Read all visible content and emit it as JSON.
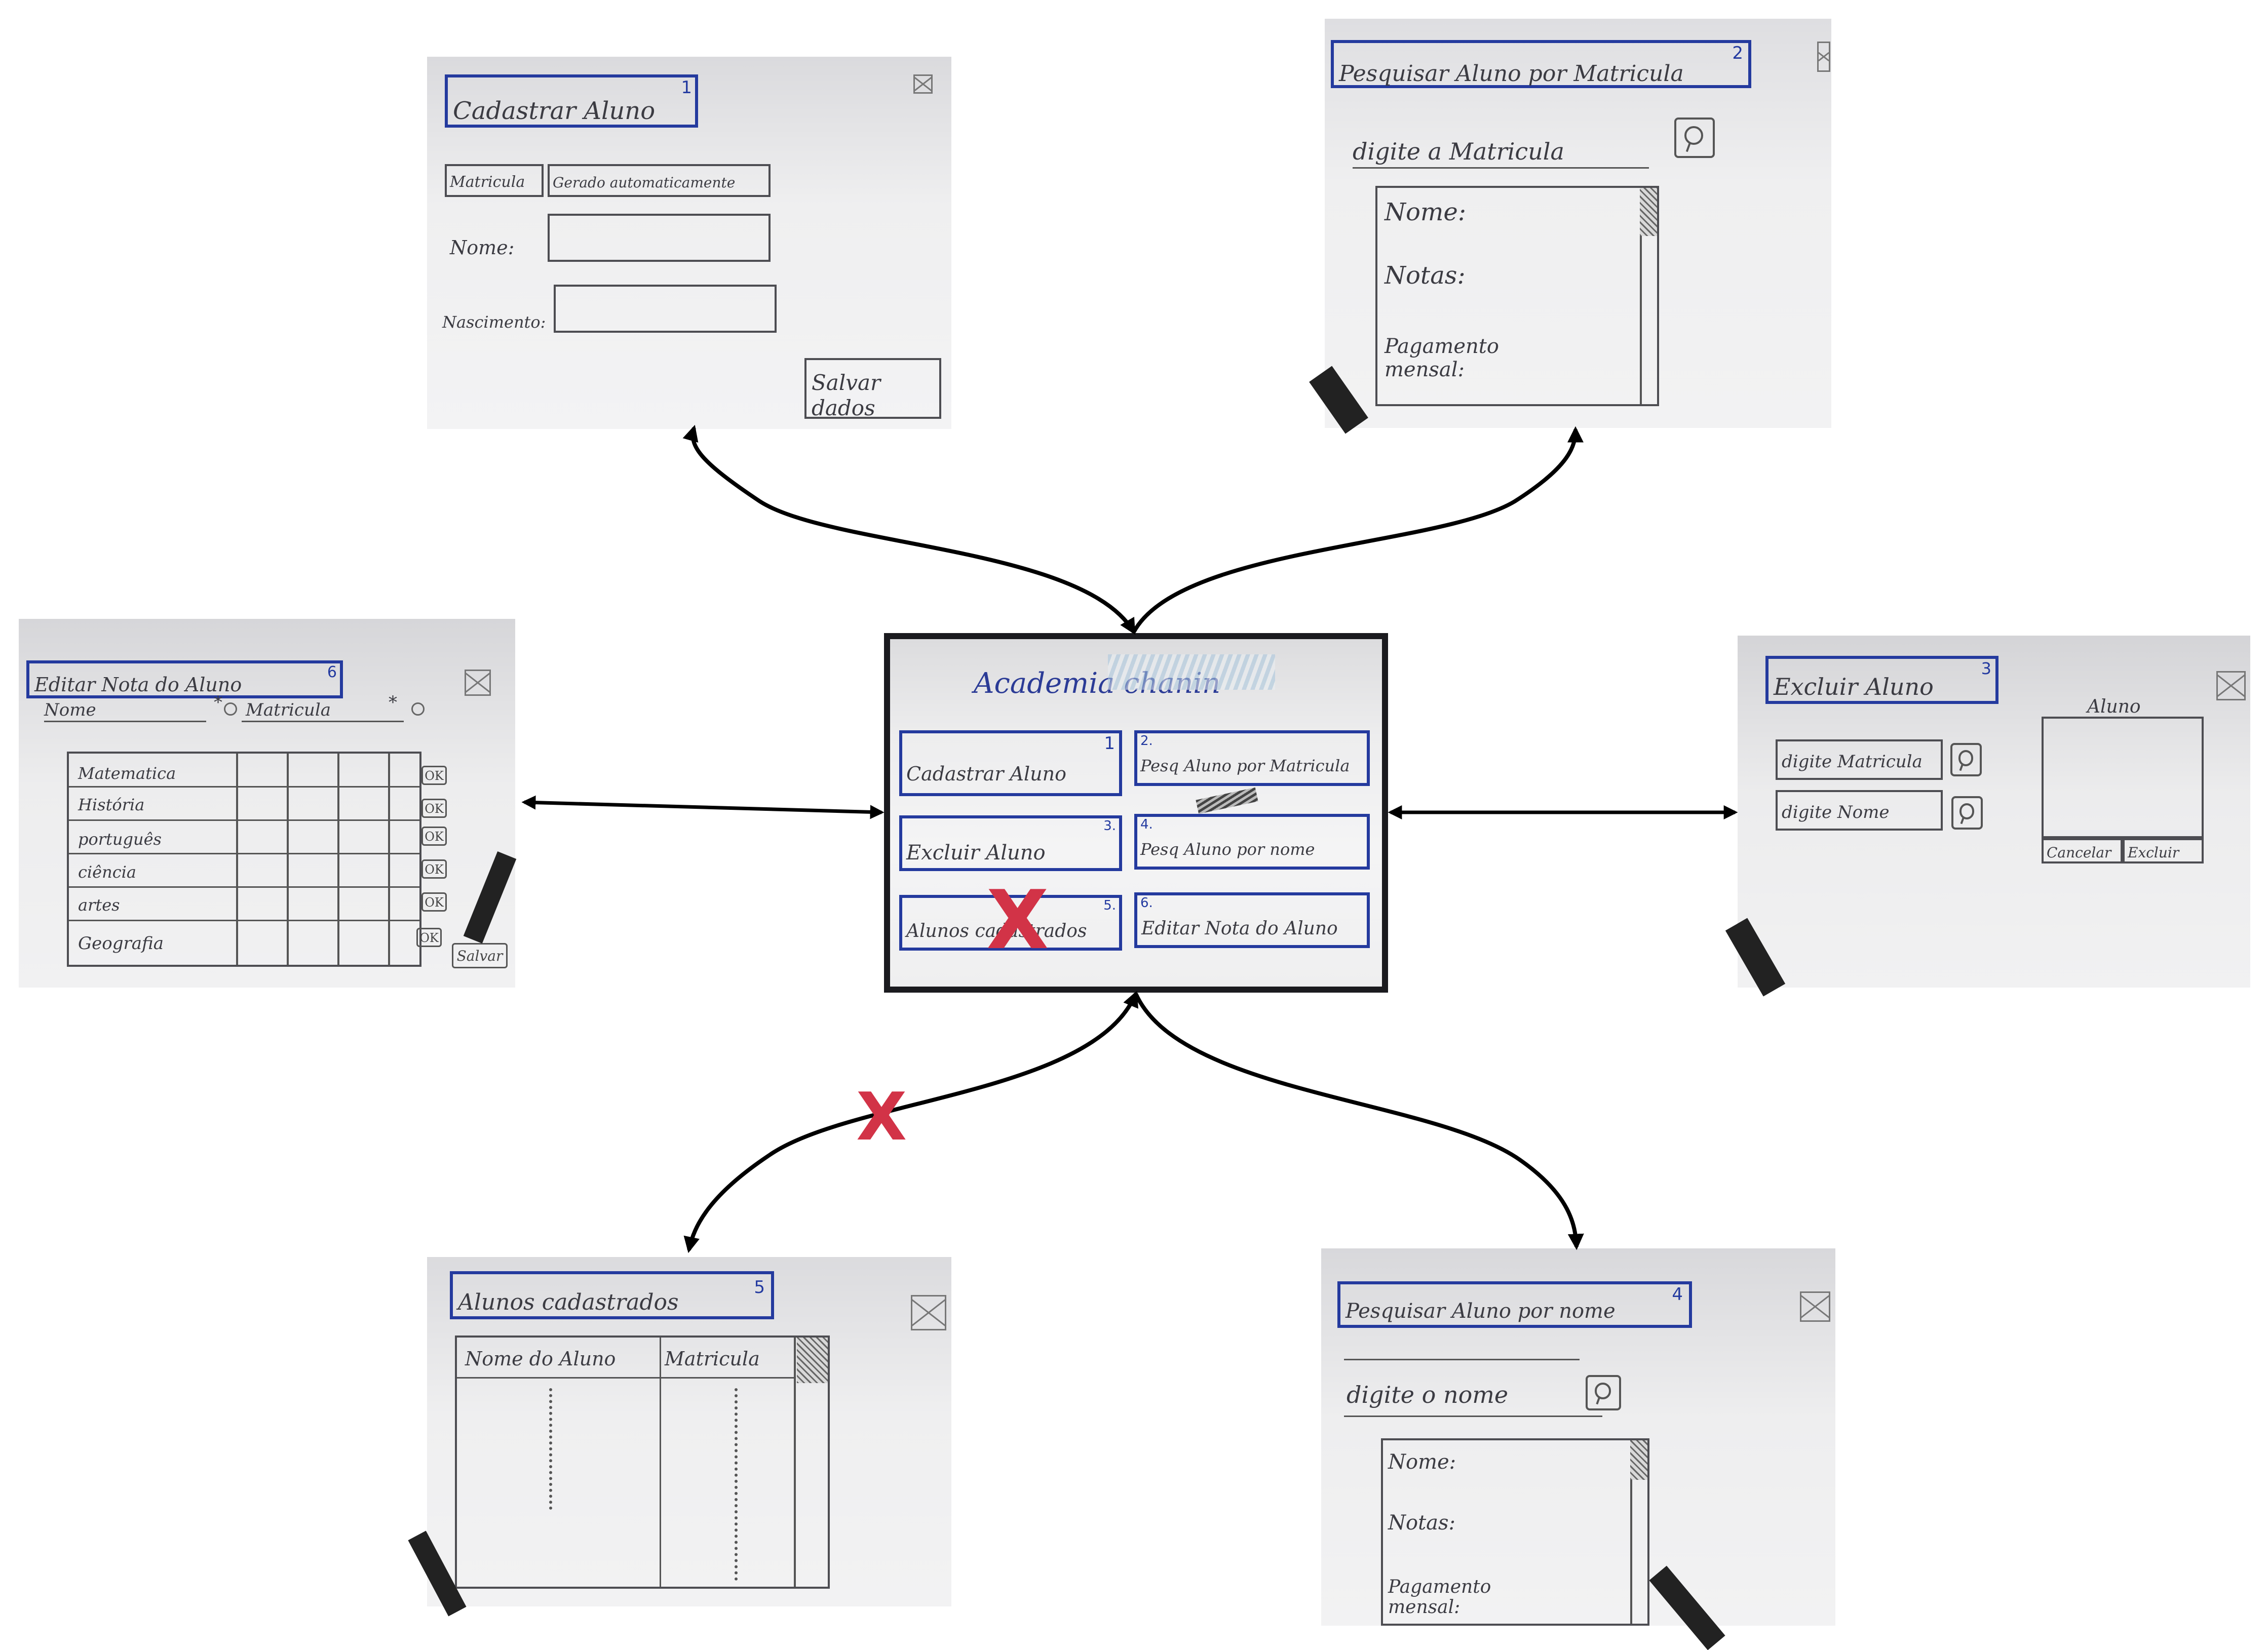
{
  "colors": {
    "sketch_blue": "#243a9e",
    "red_x": "#d23347",
    "arrow": "#000000"
  },
  "center": {
    "title": "Academia chanin",
    "items": [
      {
        "label": "Cadastrar Aluno",
        "num": "1"
      },
      {
        "label": "Pesq Aluno por Matricula",
        "num": "2."
      },
      {
        "label": "Excluir Aluno",
        "num": "3."
      },
      {
        "label": "Pesq Aluno por nome",
        "num": "4."
      },
      {
        "label": "Alunos cadastrados",
        "num": "5."
      },
      {
        "label": "Editar Nota do Aluno",
        "num": "6."
      }
    ],
    "x_mark": "X"
  },
  "s1": {
    "title": "Cadastrar Aluno",
    "num": "1",
    "matricula_label": "Matricula",
    "matricula_value": "Gerado automaticamente",
    "nome_label": "Nome:",
    "nasc_label": "Nascimento:",
    "save_button": "Salvar dados"
  },
  "s2": {
    "title": "Pesquisar Aluno por Matricula",
    "num": "2",
    "input_label": "digite a Matricula",
    "fields": [
      "Nome:",
      "Notas:",
      "Pagamento mensal:"
    ]
  },
  "s3": {
    "title": "Excluir Aluno",
    "num": "3",
    "input1": "digite Matricula",
    "input2": "digite Nome",
    "panel_title": "Aluno",
    "cancel": "Cancelar",
    "delete": "Excluir"
  },
  "s4": {
    "title": "Pesquisar Aluno por nome",
    "num": "4",
    "input_label": "digite o nome",
    "fields": [
      "Nome:",
      "Notas:",
      "Pagamento mensal:"
    ]
  },
  "s5": {
    "title": "Alunos cadastrados",
    "num": "5",
    "col1": "Nome do Aluno",
    "col2": "Matricula"
  },
  "s6": {
    "title": "Editar Nota do Aluno",
    "num": "6",
    "search_nome": "Nome",
    "search_matricula": "Matricula",
    "star": "*",
    "subjects": [
      "Matematica",
      "História",
      "português",
      "ciência",
      "artes",
      "Geografia"
    ],
    "ok": "OK",
    "save": "Salvar"
  },
  "flow_x_mark": "X"
}
